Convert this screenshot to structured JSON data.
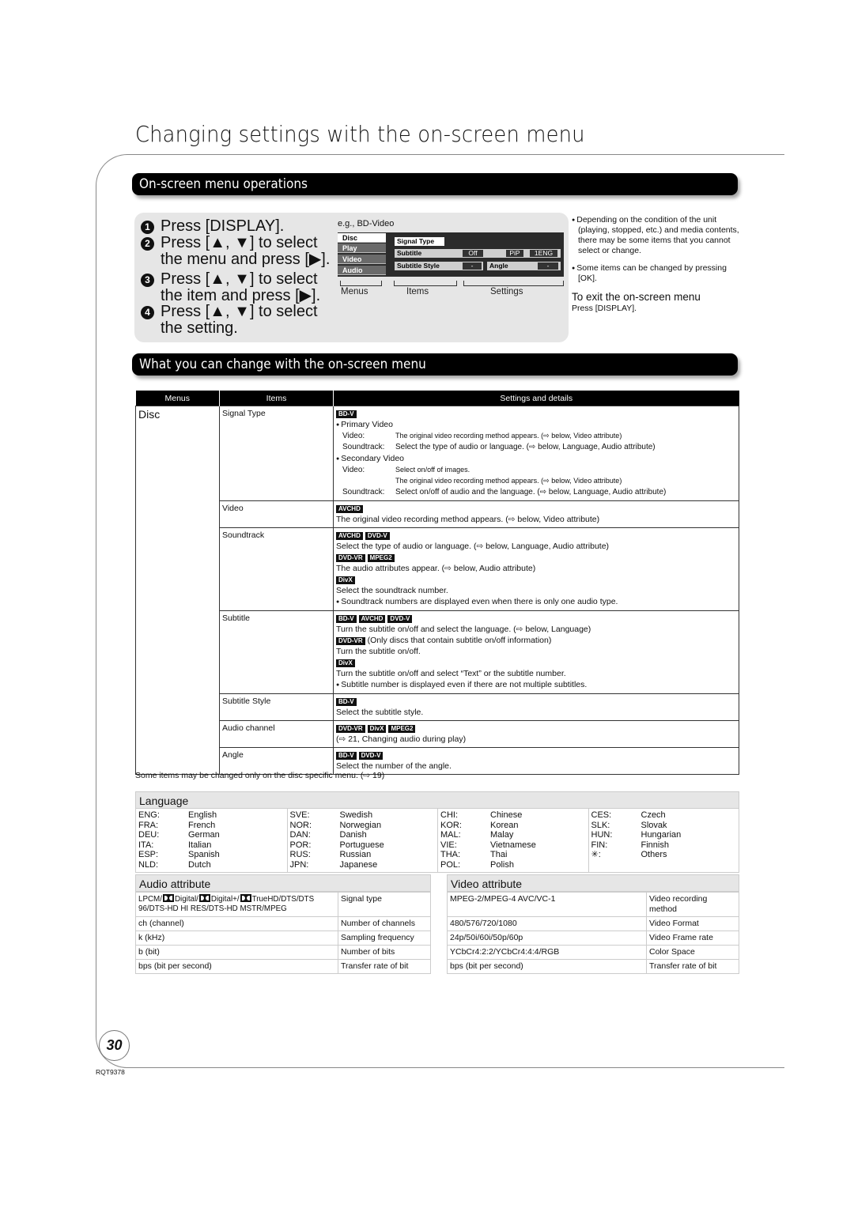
{
  "page": {
    "title": "Changing settings with the on-screen menu",
    "page_number": "30",
    "doc_code": "RQT9378"
  },
  "operations": {
    "section_title": "On-screen menu operations",
    "steps": [
      {
        "num": "1",
        "lines": [
          "Press [DISPLAY]."
        ]
      },
      {
        "num": "2",
        "lines": [
          "Press [▲, ▼] to select",
          "the menu and press [▶]."
        ]
      },
      {
        "num": "3",
        "lines": [
          "Press [▲, ▼] to select",
          "the item and press [▶]."
        ]
      },
      {
        "num": "4",
        "lines": [
          "Press [▲, ▼] to select",
          "the setting."
        ]
      }
    ],
    "example": {
      "caption": "e.g., BD-Video",
      "menus": [
        "Disc",
        "Play",
        "Video",
        "Audio"
      ],
      "items": {
        "signal_type": "Signal Type",
        "subtitle": "Subtitle",
        "subtitle_value": "Off",
        "pip": "PiP",
        "pip_value": "1ENG",
        "subtitle_style": "Subtitle Style",
        "subtitle_style_value": "-",
        "angle": "Angle",
        "angle_value": "-"
      },
      "labels": {
        "menus": "Menus",
        "items": "Items",
        "settings": "Settings"
      }
    },
    "notes": [
      "Depending on the condition of the unit (playing, stopped, etc.) and media contents, there may be some items that you cannot select or change.",
      "Some items can be changed by pressing [OK]."
    ],
    "exit_title": "To exit the on-screen menu",
    "exit_text": "Press [DISPLAY]."
  },
  "changes": {
    "section_title": "What you can change with the on-screen menu",
    "headers": [
      "Menus",
      "Items",
      "Settings and details"
    ],
    "menu": "Disc",
    "rows": {
      "signal_type": {
        "item": "Signal Type",
        "badges": [
          "BD-V"
        ],
        "primary": "Primary Video",
        "p_video_k": "Video:",
        "p_video_v": "The original video recording method appears. (⇨ below, Video attribute)",
        "p_sound_k": "Soundtrack:",
        "p_sound_v": "Select the type of audio or language. (⇨ below, Language, Audio attribute)",
        "secondary": "Secondary Video",
        "s_video_k": "Video:",
        "s_video_v1": "Select on/off of images.",
        "s_video_v2": "The original video recording method appears. (⇨ below, Video attribute)",
        "s_sound_k": "Soundtrack:",
        "s_sound_v": "Select on/off of audio and the language. (⇨ below, Language, Audio attribute)"
      },
      "video": {
        "item": "Video",
        "badges": [
          "AVCHD"
        ],
        "text": "The original video recording method appears. (⇨ below, Video attribute)"
      },
      "soundtrack": {
        "item": "Soundtrack",
        "badges1": [
          "AVCHD",
          "DVD-V"
        ],
        "text1": "Select the type of audio or language. (⇨ below, Language, Audio attribute)",
        "badges2": [
          "DVD-VR",
          "MPEG2"
        ],
        "text2": "The audio attributes appear. (⇨ below, Audio attribute)",
        "badges3": [
          "DivX"
        ],
        "text3": "Select the soundtrack number.",
        "note": "Soundtrack numbers are displayed even when there is only one audio type."
      },
      "subtitle": {
        "item": "Subtitle",
        "badges1": [
          "BD-V",
          "AVCHD",
          "DVD-V"
        ],
        "text1": "Turn the subtitle on/off and select the language. (⇨ below, Language)",
        "badges2": [
          "DVD-VR"
        ],
        "text2a": "(Only discs that contain subtitle on/off information)",
        "text2b": "Turn the subtitle on/off.",
        "badges3": [
          "DivX"
        ],
        "text3": "Turn the subtitle on/off and select “Text” or the subtitle number.",
        "note": "Subtitle number is displayed even if there are not multiple subtitles."
      },
      "subtitle_style": {
        "item": "Subtitle Style",
        "badges": [
          "BD-V"
        ],
        "text": "Select the subtitle style."
      },
      "audio_channel": {
        "item": "Audio channel",
        "badges": [
          "DVD-VR",
          "DivX",
          "MPEG2"
        ],
        "text": "(⇨ 21, Changing audio during play)"
      },
      "angle": {
        "item": "Angle",
        "badges": [
          "BD-V",
          "DVD-V"
        ],
        "text": "Select the number of the angle."
      }
    },
    "footnote": "Some items may be changed only on the disc specific menu. (⇨ 19)"
  },
  "language": {
    "title": "Language",
    "columns": [
      [
        [
          "ENG:",
          "English"
        ],
        [
          "FRA:",
          "French"
        ],
        [
          "DEU:",
          "German"
        ],
        [
          "ITA:",
          "Italian"
        ],
        [
          "ESP:",
          "Spanish"
        ],
        [
          "NLD:",
          "Dutch"
        ]
      ],
      [
        [
          "SVE:",
          "Swedish"
        ],
        [
          "NOR:",
          "Norwegian"
        ],
        [
          "DAN:",
          "Danish"
        ],
        [
          "POR:",
          "Portuguese"
        ],
        [
          "RUS:",
          "Russian"
        ],
        [
          "JPN:",
          "Japanese"
        ]
      ],
      [
        [
          "CHI:",
          "Chinese"
        ],
        [
          "KOR:",
          "Korean"
        ],
        [
          "MAL:",
          "Malay"
        ],
        [
          "VIE:",
          "Vietnamese"
        ],
        [
          "THA:",
          "Thai"
        ],
        [
          "POL:",
          "Polish"
        ]
      ],
      [
        [
          "CES:",
          "Czech"
        ],
        [
          "SLK:",
          "Slovak"
        ],
        [
          "HUN:",
          "Hungarian"
        ],
        [
          "FIN:",
          "Finnish"
        ],
        [
          "✳:",
          "Others"
        ]
      ]
    ]
  },
  "audio_attribute": {
    "title": "Audio attribute",
    "signal_type_parts": [
      "LPCM/",
      "Digital/",
      "Digital+/",
      "TrueHD/DTS/DTS 96/DTS-HD HI RES/DTS-HD MSTR/MPEG"
    ],
    "rows": [
      [
        "",
        "Signal type"
      ],
      [
        "ch (channel)",
        "Number of channels"
      ],
      [
        "k (kHz)",
        "Sampling frequency"
      ],
      [
        "b (bit)",
        "Number of bits"
      ],
      [
        "bps (bit per second)",
        "Transfer rate of bit"
      ]
    ]
  },
  "video_attribute": {
    "title": "Video attribute",
    "rows": [
      [
        "MPEG-2/MPEG-4 AVC/VC-1",
        "Video recording method"
      ],
      [
        "480/576/720/1080",
        "Video Format"
      ],
      [
        "24p/50i/60i/50p/60p",
        "Video Frame rate"
      ],
      [
        "YCbCr4:2:2/YCbCr4:4:4/RGB",
        "Color Space"
      ],
      [
        "bps (bit per second)",
        "Transfer rate of bit"
      ]
    ]
  }
}
